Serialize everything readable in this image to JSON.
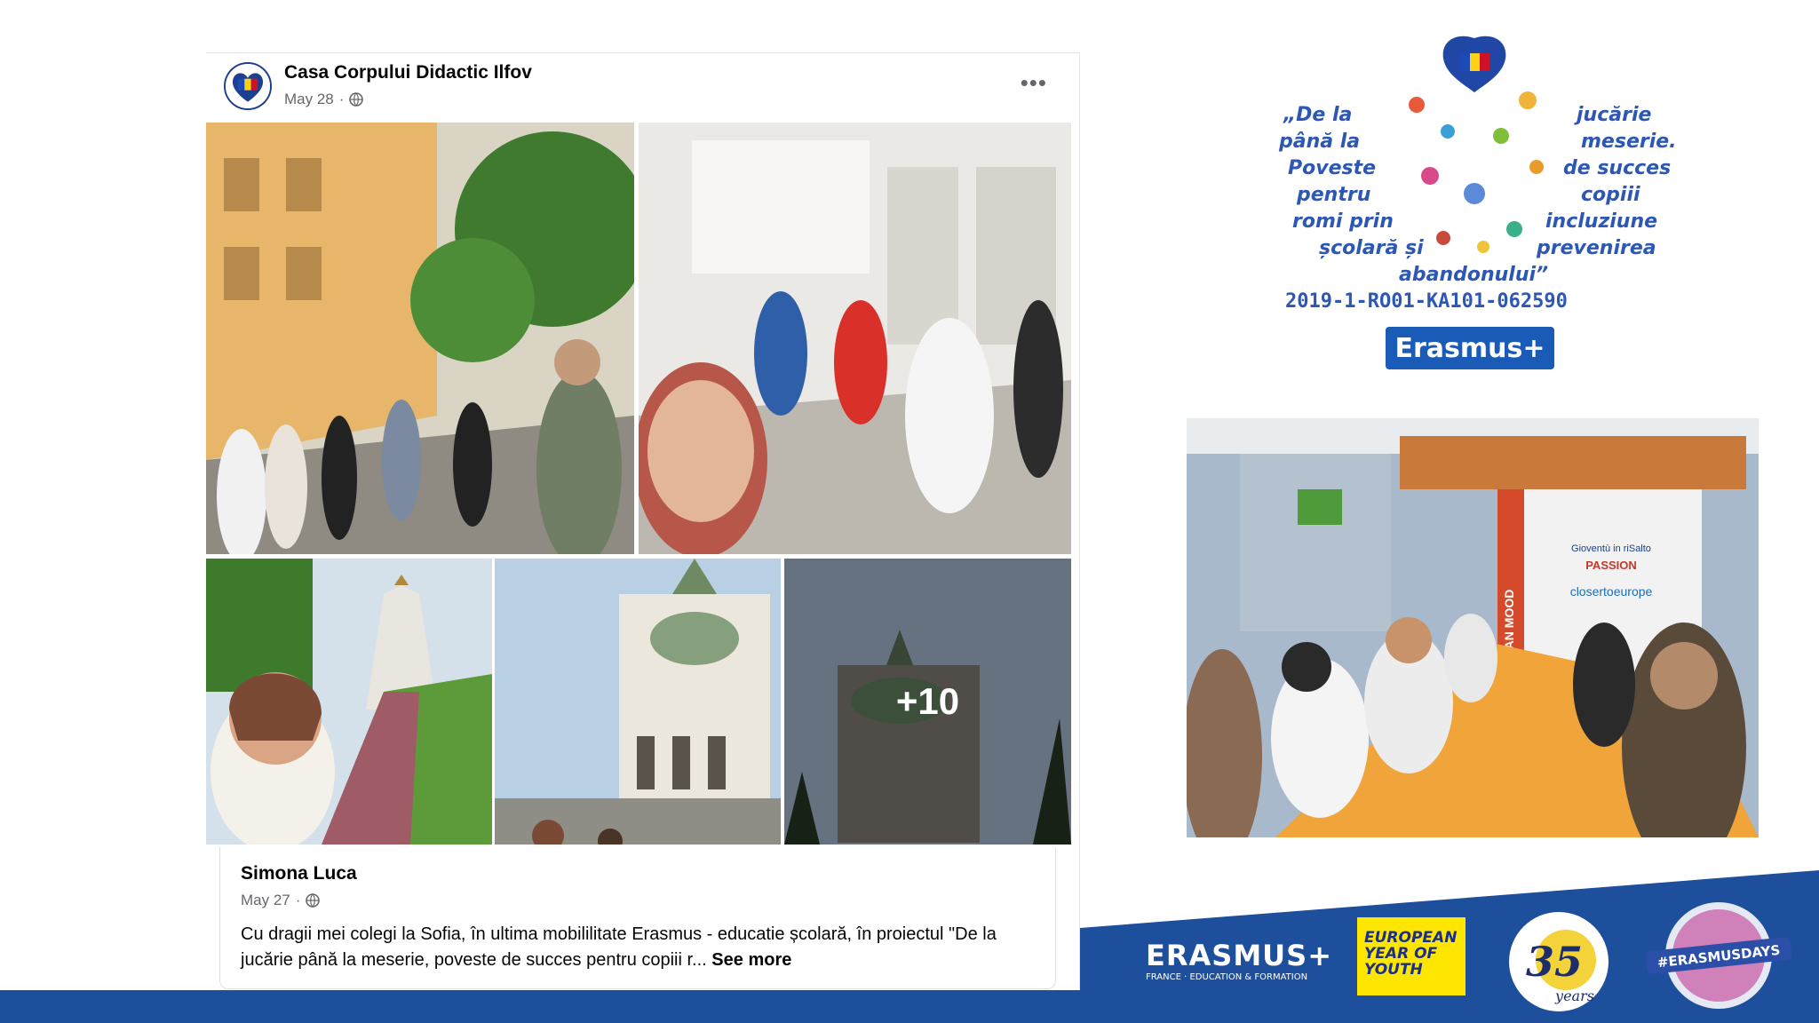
{
  "post": {
    "author": "Casa Corpului Didactic Ilfov",
    "date": "May 28",
    "separator": "·",
    "more_icon": "more-options-icon",
    "overlay_count": "+10"
  },
  "shared_post": {
    "author": "Simona Luca",
    "date": "May 27",
    "separator": "·",
    "text": "Cu dragii mei colegi la Sofia, în ultima mobililitate Erasmus - educatie școlară, în proiectul \"De la jucărie până la meserie, poveste de succes pentru copiii r...",
    "see_more": "See more"
  },
  "project_logo": {
    "title_lines": [
      "„De la",
      "până la",
      "Poveste",
      "pentru",
      "romi prin",
      "școlară și",
      "abandonului”"
    ],
    "right_lines": [
      "jucărie",
      "meserie.",
      "de succes",
      "copiii",
      "incluziune",
      "prevenirea"
    ],
    "code": "2019-1-RO01-KA101-062590",
    "brand": "Erasmus+"
  },
  "workshop_banner": {
    "lines": [
      "Gioventù in riSalto",
      "PASSION",
      "closertoeurope",
      "RANEAN MOOD"
    ]
  },
  "footer": {
    "erasmus_logo": "ERASMUS+",
    "erasmus_sub": "FRANCE · EDUCATION & FORMATION",
    "eyy_lines": [
      "EUROPEAN",
      "YEAR OF",
      "YOUTH"
    ],
    "anniversary": "35",
    "anniversary_sub": "years",
    "hashtag": "#ERASMUSDAYS"
  },
  "colors": {
    "facebook_text": "#050505",
    "facebook_meta": "#65676b",
    "footer_blue": "#1d4f9c",
    "erasmus_blue": "#1a5bb8",
    "eyy_yellow": "#ffe600"
  }
}
